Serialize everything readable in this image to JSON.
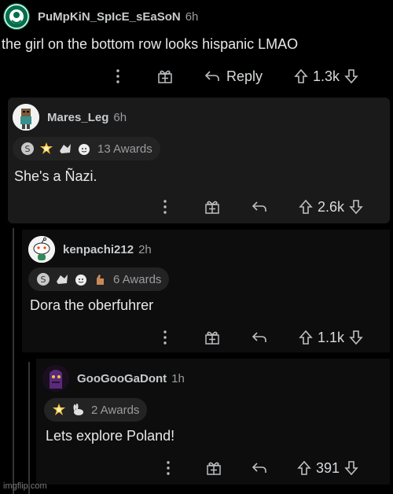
{
  "comments": [
    {
      "username": "PuMpKiN_SpIcE_sEaSoN",
      "time": "6h",
      "body": "the girl on the bottom row looks hispanic LMAO",
      "reply_label": "Reply",
      "score": "1.3k",
      "avatar_icon": "starbucks-logo-avatar"
    },
    {
      "username": "Mares_Leg",
      "time": "6h",
      "awards_label": "13 Awards",
      "body": "She's a Ñazi.",
      "score": "2.6k",
      "avatar_icon": "pixel-character-avatar"
    },
    {
      "username": "kenpachi212",
      "time": "2h",
      "awards_label": "6 Awards",
      "body": "Dora the oberfuhrer",
      "score": "1.1k",
      "avatar_icon": "snoo-avatar"
    },
    {
      "username": "GooGooGaDont",
      "time": "1h",
      "awards_label": "2 Awards",
      "body": "Lets explore Poland!",
      "score": "391",
      "avatar_icon": "purple-character-avatar"
    }
  ],
  "watermark": "imgflip.com",
  "colors": {
    "background": "#000000",
    "card": "#1a1a1b",
    "text": "#d7dadc",
    "muted": "#9a9c9e"
  }
}
